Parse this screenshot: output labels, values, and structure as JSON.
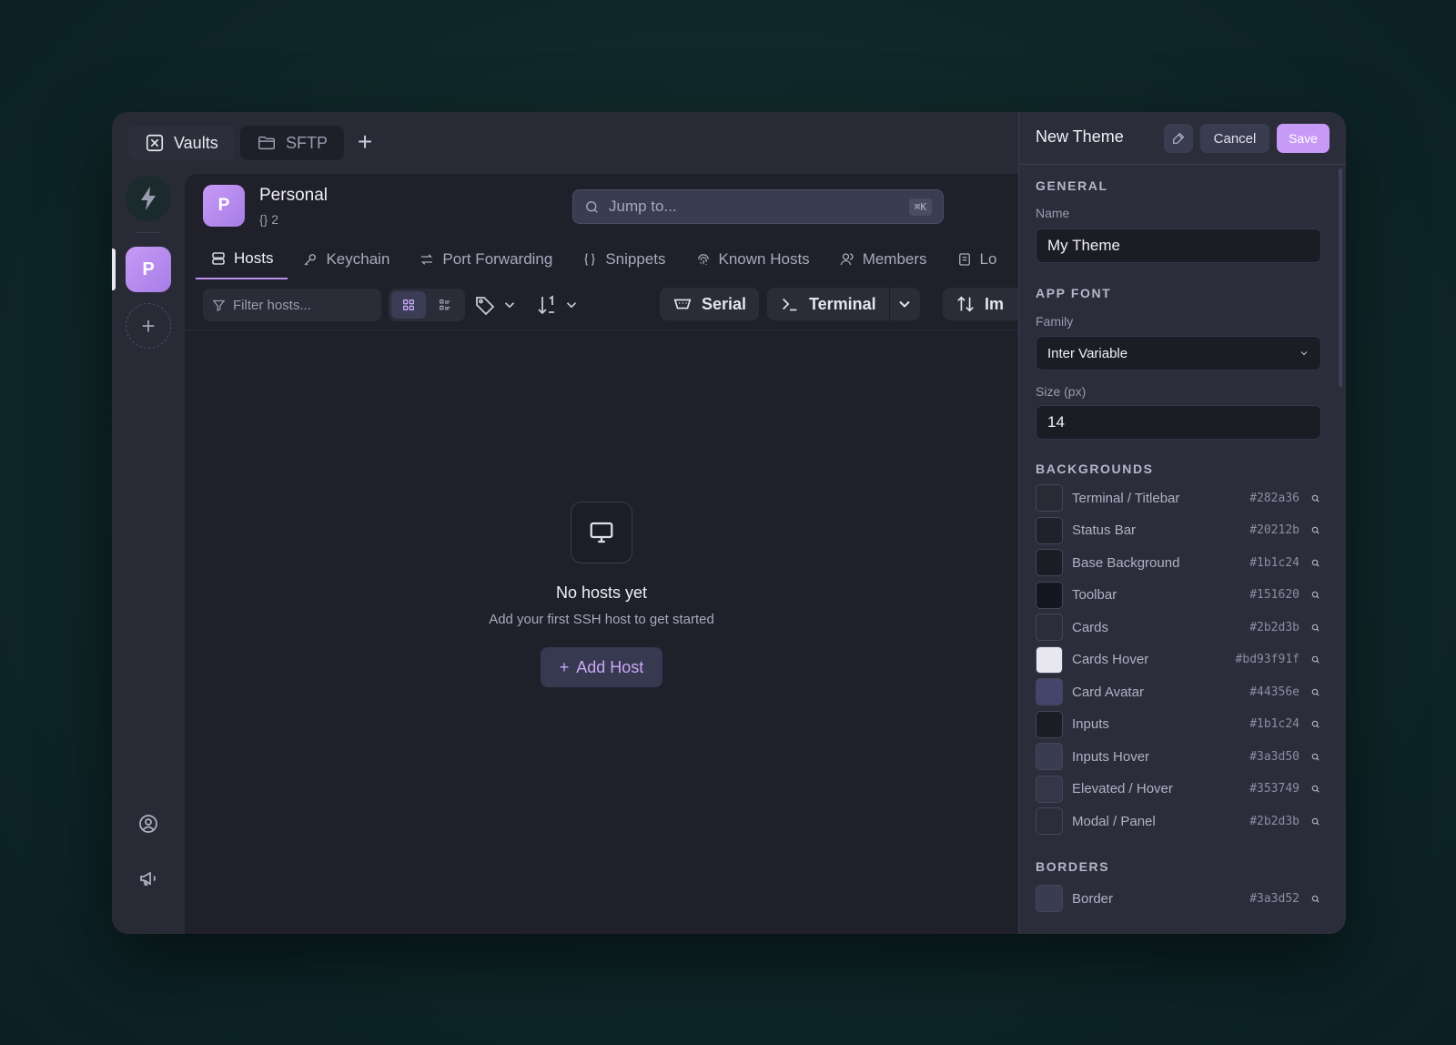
{
  "tabs": [
    {
      "label": "Vaults",
      "icon": "vault-icon"
    },
    {
      "label": "SFTP",
      "icon": "folder-icon"
    }
  ],
  "vault": {
    "initial": "P",
    "name": "Personal",
    "meta": "{} 2"
  },
  "search": {
    "placeholder": "Jump to...",
    "shortcut": "⌘K"
  },
  "nav": [
    {
      "label": "Hosts",
      "icon": "server-icon",
      "active": true
    },
    {
      "label": "Keychain",
      "icon": "key-icon"
    },
    {
      "label": "Port Forwarding",
      "icon": "arrows-icon"
    },
    {
      "label": "Snippets",
      "icon": "braces-icon"
    },
    {
      "label": "Known Hosts",
      "icon": "fingerprint-icon"
    },
    {
      "label": "Members",
      "icon": "members-icon"
    },
    {
      "label": "Lo",
      "icon": "logs-icon"
    }
  ],
  "toolbar": {
    "filter_placeholder": "Filter hosts...",
    "serial_label": "Serial",
    "terminal_label": "Terminal",
    "import_label": "Im"
  },
  "empty": {
    "title": "No hosts yet",
    "subtitle": "Add your first SSH host to get started",
    "button": "Add Host"
  },
  "panel": {
    "title": "New Theme",
    "cancel": "Cancel",
    "save": "Save",
    "general_heading": "GENERAL",
    "name_label": "Name",
    "name_value": "My Theme",
    "font_heading": "APP FONT",
    "family_label": "Family",
    "family_value": "Inter Variable",
    "size_label": "Size (px)",
    "size_value": "14",
    "backgrounds_heading": "BACKGROUNDS",
    "borders_heading": "BORDERS",
    "backgrounds": [
      {
        "name": "Terminal / Titlebar",
        "hex": "#282a36",
        "color": "#282a36"
      },
      {
        "name": "Status Bar",
        "hex": "#20212b",
        "color": "#20212b"
      },
      {
        "name": "Base Background",
        "hex": "#1b1c24",
        "color": "#1b1c24"
      },
      {
        "name": "Toolbar",
        "hex": "#151620",
        "color": "#151620"
      },
      {
        "name": "Cards",
        "hex": "#2b2d3b",
        "color": "#2b2d3b"
      },
      {
        "name": "Cards Hover",
        "hex": "#bd93f91f",
        "color": "#e8e6ee"
      },
      {
        "name": "Card Avatar",
        "hex": "#44356e",
        "color": "#44456a"
      },
      {
        "name": "Inputs",
        "hex": "#1b1c24",
        "color": "#1b1c24"
      },
      {
        "name": "Inputs Hover",
        "hex": "#3a3d50",
        "color": "#3a3d50"
      },
      {
        "name": "Elevated / Hover",
        "hex": "#353749",
        "color": "#353749"
      },
      {
        "name": "Modal / Panel",
        "hex": "#2b2d3b",
        "color": "#2b2d3b"
      }
    ],
    "borders": [
      {
        "name": "Border",
        "hex": "#3a3d52",
        "color": "#3a3d52"
      }
    ]
  },
  "colors": {
    "accent": "#c79af6",
    "window_bg": "#282a36",
    "main_bg": "#1f202a",
    "panel_bg": "#2b2d3b"
  }
}
